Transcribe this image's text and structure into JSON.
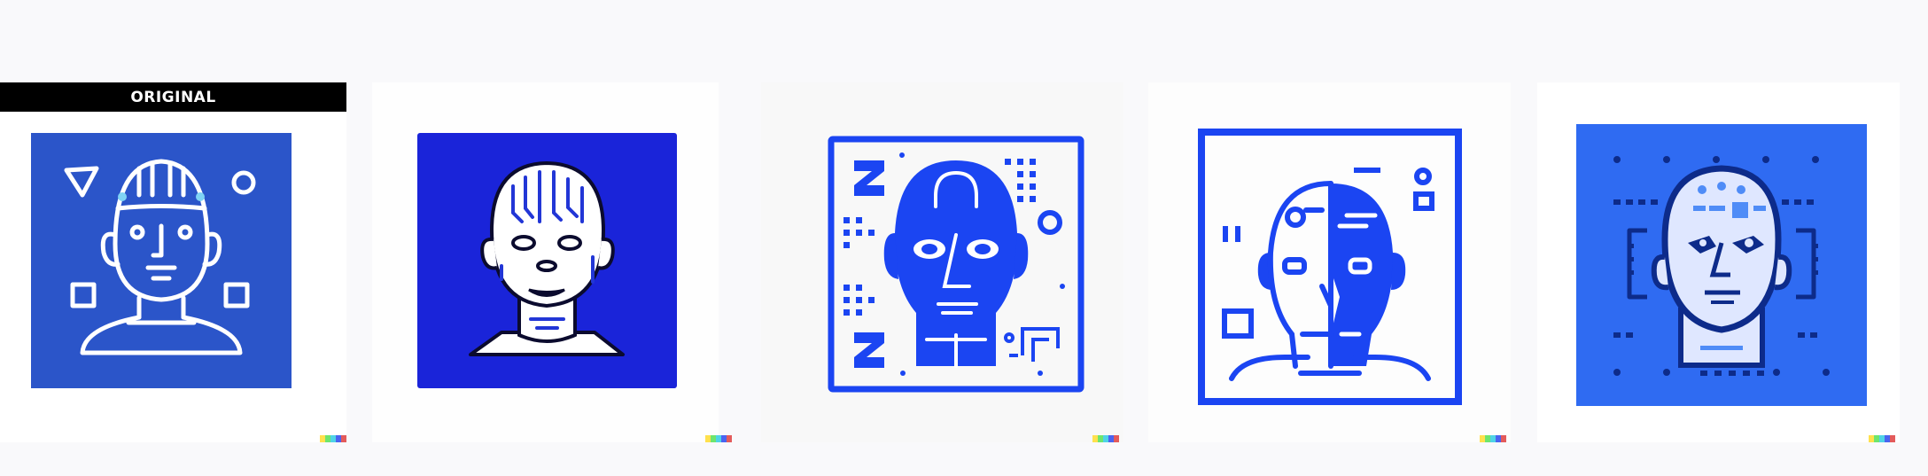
{
  "gallery": {
    "original_label": "ORIGINAL",
    "images": [
      {
        "role": "original",
        "icon": "robot-head-circuit-icon",
        "background": "#2b55c9"
      },
      {
        "role": "variation",
        "icon": "robot-head-circuit-icon",
        "background": "#1a24d9"
      },
      {
        "role": "variation",
        "icon": "robot-head-framed-icon",
        "background": "#f8f8f8"
      },
      {
        "role": "variation",
        "icon": "cyborg-half-face-icon",
        "background": "#fdfdfd"
      },
      {
        "role": "variation",
        "icon": "robot-head-dotted-icon",
        "background": "#2f6bf2"
      }
    ],
    "signature_colors": [
      "#ffe14d",
      "#6ee56e",
      "#4fd3e6",
      "#4a64f0",
      "#e35b5b"
    ]
  }
}
